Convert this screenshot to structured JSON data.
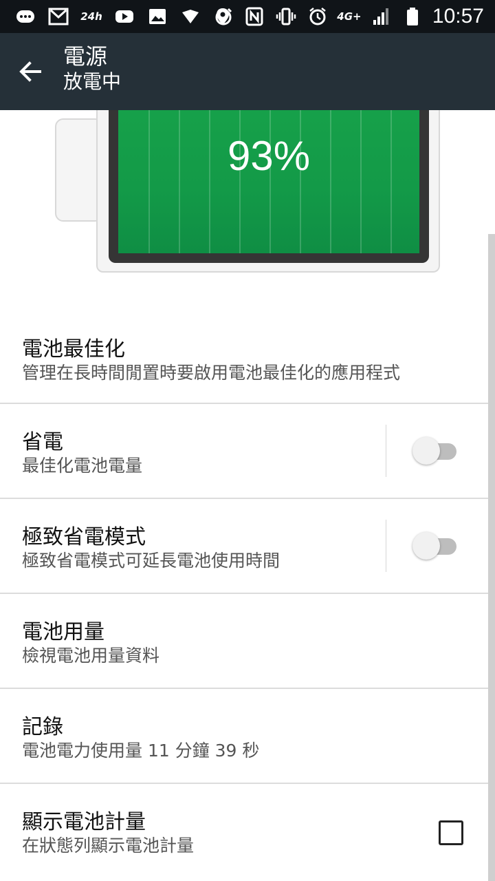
{
  "status_bar": {
    "left_icons": [
      "chat-bubble-icon",
      "gmail-icon",
      "24h-icon",
      "youtube-icon",
      "gallery-icon",
      "shield-icon",
      "food-delivery-icon"
    ],
    "speed_label": "24h",
    "right_icons": [
      "location-icon",
      "nfc-icon",
      "vibrate-icon",
      "alarm-icon",
      "4g-icon",
      "signal-icon",
      "battery-icon"
    ],
    "network_label": "4G+",
    "time": "10:57"
  },
  "app_bar": {
    "title": "電源",
    "subtitle": "放電中"
  },
  "battery": {
    "level_percent": 93,
    "label": "93%",
    "fill_color": "#139A48"
  },
  "settings": {
    "items": [
      {
        "title": "電池最佳化",
        "summary": "管理在長時間閒置時要啟用電池最佳化的應用程式"
      },
      {
        "title": "省電",
        "summary": "最佳化電池電量",
        "control": "toggle",
        "checked": false
      },
      {
        "title": "極致省電模式",
        "summary": "極致省電模式可延長電池使用時間",
        "control": "toggle",
        "checked": false
      },
      {
        "title": "電池用量",
        "summary": "檢視電池用量資料"
      },
      {
        "title": "記錄",
        "summary": "電池電力使用量 11 分鐘 39 秒"
      },
      {
        "title": "顯示電池計量",
        "summary": "在狀態列顯示電池計量",
        "control": "checkbox",
        "checked": false
      }
    ]
  },
  "colors": {
    "app_bar_bg": "#253038",
    "status_bar_bg": "#101418",
    "battery_green": "#139A48"
  }
}
